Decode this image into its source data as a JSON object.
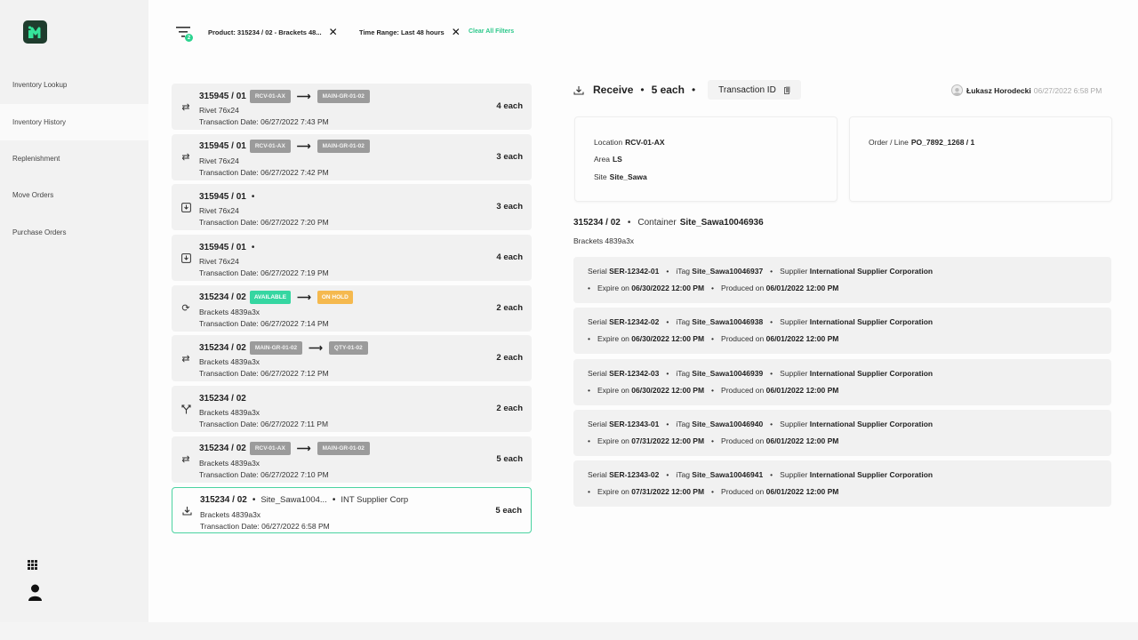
{
  "sidebar": {
    "items": [
      {
        "label": "Inventory Lookup"
      },
      {
        "label": "Inventory History"
      },
      {
        "label": "Replenishment"
      },
      {
        "label": "Move Orders"
      },
      {
        "label": "Purchase Orders"
      }
    ]
  },
  "filters": {
    "count": "2",
    "product": "Product: 315234 / 02 - Brackets 48...",
    "time_range": "Time Range: Last 48 hours",
    "clear_all": "Clear All Filters"
  },
  "transactions": [
    {
      "title": "315945 / 01",
      "from": "RCV-01-AX",
      "to": "MAIN-GR-01-02",
      "item": "Rivet 76x24",
      "date": "Transaction Date: 06/27/2022 7:43 PM",
      "qty": "4 each",
      "icon": "move-icon"
    },
    {
      "title": "315945 / 01",
      "from": "RCV-01-AX",
      "to": "MAIN-GR-01-02",
      "item": "Rivet 76x24",
      "date": "Transaction Date: 06/27/2022 7:42 PM",
      "qty": "3 each",
      "icon": "move-icon"
    },
    {
      "title": "315945 / 01",
      "item": "Rivet 76x24",
      "date": "Transaction Date: 06/27/2022 7:20 PM",
      "qty": "3 each",
      "icon": "receive-icon"
    },
    {
      "title": "315945 / 01",
      "item": "Rivet 76x24",
      "date": "Transaction Date: 06/27/2022 7:19 PM",
      "qty": "4 each",
      "icon": "receive-icon"
    },
    {
      "title": "315234 / 02",
      "status_from": "AVAILABLE",
      "status_to": "ON HOLD",
      "item": "Brackets 4839a3x",
      "date": "Transaction Date: 06/27/2022 7:14 PM",
      "qty": "2 each",
      "icon": "status-change-icon"
    },
    {
      "title": "315234 / 02",
      "from": "MAIN-GR-01-02",
      "to": "QTY-01-02",
      "item": "Brackets 4839a3x",
      "date": "Transaction Date: 06/27/2022 7:12 PM",
      "qty": "2 each",
      "icon": "move-icon"
    },
    {
      "title": "315234 / 02",
      "item": "Brackets 4839a3x",
      "date": "Transaction Date: 06/27/2022 7:11 PM",
      "qty": "2 each",
      "icon": "split-icon"
    },
    {
      "title": "315234 / 02",
      "from": "RCV-01-AX",
      "to": "MAIN-GR-01-02",
      "item": "Brackets 4839a3x",
      "date": "Transaction Date: 06/27/2022 7:10 PM",
      "qty": "5 each",
      "icon": "move-icon"
    },
    {
      "title": "315234 / 02",
      "site": "Site_Sawa1004...",
      "supplier": "INT Supplier Corp",
      "item": "Brackets 4839a3x",
      "date": "Transaction Date: 06/27/2022 6:58 PM",
      "qty": "5 each",
      "icon": "download-icon",
      "selected": true
    }
  ],
  "detail": {
    "type": "Receive",
    "qty": "5 each",
    "txid_label": "Transaction ID",
    "user": "Łukasz Horodecki",
    "timestamp": "06/27/2022 6:58 PM",
    "location_label": "Location",
    "location": "RCV-01-AX",
    "area_label": "Area",
    "area": "LS",
    "site_label": "Site",
    "site": "Site_Sawa",
    "order_label": "Order / Line",
    "order": "PO_7892_1268 / 1",
    "product": "315234 / 02",
    "container_label": "Container",
    "container": "Site_Sawa10046936",
    "product_desc": "Brackets 4839a3x"
  },
  "serials": [
    {
      "serial": "SER-12342-01",
      "itag": "Site_Sawa10046937",
      "supplier": "International Supplier Corporation",
      "expire": "06/30/2022 12:00 PM",
      "produced": "06/01/2022 12:00 PM"
    },
    {
      "serial": "SER-12342-02",
      "itag": "Site_Sawa10046938",
      "supplier": "International Supplier Corporation",
      "expire": "06/30/2022 12:00 PM",
      "produced": "06/01/2022 12:00 PM"
    },
    {
      "serial": "SER-12342-03",
      "itag": "Site_Sawa10046939",
      "supplier": "International Supplier Corporation",
      "expire": "06/30/2022 12:00 PM",
      "produced": "06/01/2022 12:00 PM"
    },
    {
      "serial": "SER-12343-01",
      "itag": "Site_Sawa10046940",
      "supplier": "International Supplier Corporation",
      "expire": "07/31/2022 12:00 PM",
      "produced": "06/01/2022 12:00 PM"
    },
    {
      "serial": "SER-12343-02",
      "itag": "Site_Sawa10046941",
      "supplier": "International Supplier Corporation",
      "expire": "07/31/2022 12:00 PM",
      "produced": "06/01/2022 12:00 PM"
    }
  ],
  "labels": {
    "serial": "Serial",
    "itag": "iTag",
    "supplier": "Supplier",
    "expire": "Expire on",
    "produced": "Produced on"
  },
  "colors": {
    "accent": "#2bd38f",
    "selected_border": "#4bd3a1",
    "on_hold": "#f5b94e",
    "location_chip": "#9b9b9b",
    "logo_bg": "#1f3d2e"
  }
}
